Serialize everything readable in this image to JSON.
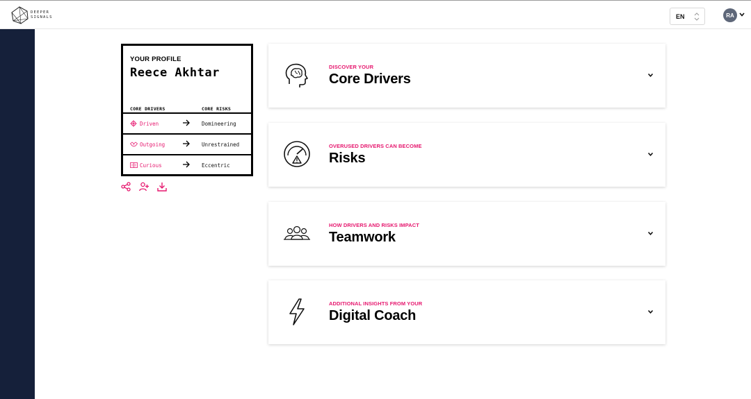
{
  "header": {
    "logo_text": [
      "DEEPER",
      "SIGNALS"
    ],
    "language": "EN",
    "avatar_initials": "RA"
  },
  "colors": {
    "accent": "#e6176e",
    "sidebar": "#15203a",
    "avatar": "#5e6779"
  },
  "profile": {
    "label": "YOUR PROFILE",
    "name": "Reece Akhtar",
    "drivers_header": "CORE DRIVERS",
    "risks_header": "CORE RISKS",
    "rows": [
      {
        "driver": "Driven",
        "risk": "Domineering",
        "icon": "target-icon"
      },
      {
        "driver": "Outgoing",
        "risk": "Unrestrained",
        "icon": "handshake-icon"
      },
      {
        "driver": "Curious",
        "risk": "Eccentric",
        "icon": "book-icon"
      }
    ],
    "actions": [
      "share-icon",
      "add-user-icon",
      "download-icon"
    ]
  },
  "sections": [
    {
      "kicker": "DISCOVER YOUR",
      "title": "Core Drivers",
      "icon": "head-brain-icon"
    },
    {
      "kicker": "OVERUSED DRIVERS CAN BECOME",
      "title": "Risks",
      "icon": "gauge-warning-icon"
    },
    {
      "kicker": "HOW DRIVERS AND RISKS IMPACT",
      "title": "Teamwork",
      "icon": "team-icon"
    },
    {
      "kicker": "ADDITIONAL INSIGHTS FROM YOUR",
      "title": "Digital Coach",
      "icon": "lightning-icon"
    }
  ]
}
